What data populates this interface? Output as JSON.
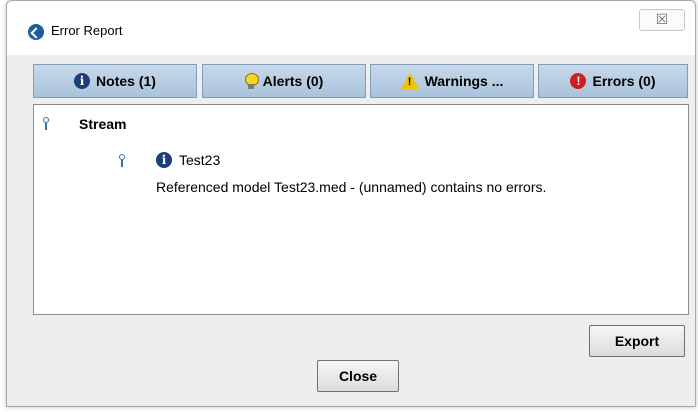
{
  "window": {
    "title": "Error Report",
    "close_glyph": "☒"
  },
  "tabs": [
    {
      "label": "Notes (1)",
      "icon": "info-icon"
    },
    {
      "label": "Alerts (0)",
      "icon": "lightbulb-icon"
    },
    {
      "label": "Warnings ...",
      "icon": "warning-icon"
    },
    {
      "label": "Errors (0)",
      "icon": "error-icon"
    }
  ],
  "tree": {
    "root_label": "Stream",
    "child_label": "Test23",
    "child_message": "Referenced model Test23.med - (unnamed) contains no errors."
  },
  "buttons": {
    "export": "Export",
    "close": "Close"
  },
  "icons": {
    "info_glyph": "i",
    "warning_glyph": "!",
    "error_glyph": "!"
  },
  "colors": {
    "tab_bg": "#b8cde2",
    "info_blue": "#1b3f7a",
    "error_red": "#d01e1e",
    "warning_yellow": "#f2c300"
  }
}
